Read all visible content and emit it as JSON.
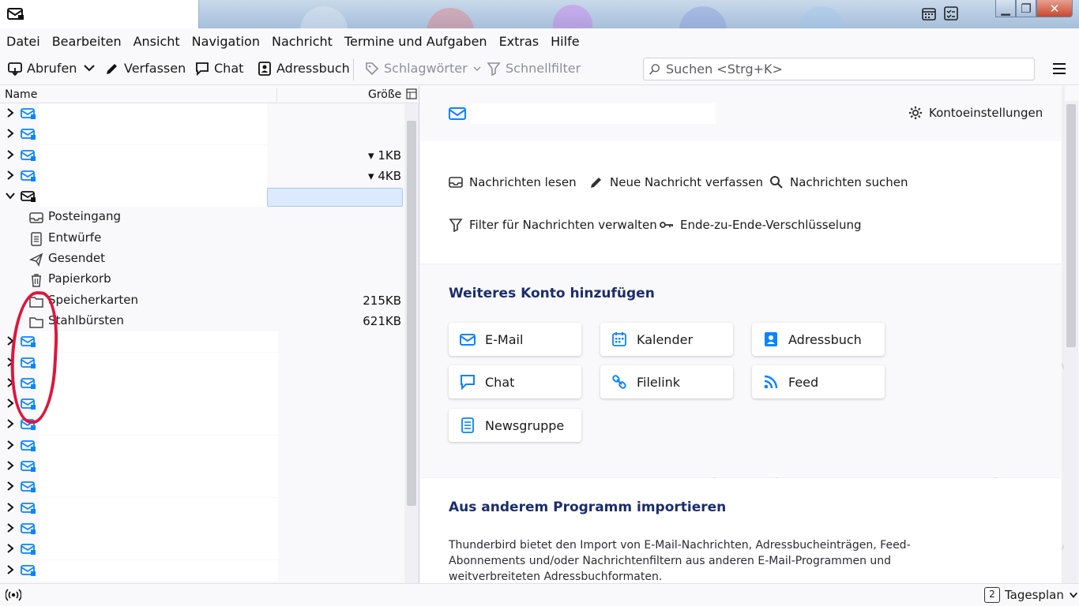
{
  "menu": [
    "Datei",
    "Bearbeiten",
    "Ansicht",
    "Navigation",
    "Nachricht",
    "Termine und Aufgaben",
    "Extras",
    "Hilfe"
  ],
  "toolbar": {
    "get_mail": "Abrufen",
    "compose": "Verfassen",
    "chat": "Chat",
    "address_book": "Adressbuch",
    "tags": "Schlagwörter",
    "quick_filter": "Schnellfilter",
    "search_placeholder": "Suchen <Strg+K>"
  },
  "folder_pane": {
    "col_name": "Name",
    "col_size": "Größe",
    "accounts_top": [
      {
        "size": ""
      },
      {
        "size": ""
      },
      {
        "size": "1KB"
      },
      {
        "size": "4KB"
      }
    ],
    "folders": [
      {
        "label": "Posteingang",
        "icon": "inbox-icon",
        "size": ""
      },
      {
        "label": "Entwürfe",
        "icon": "drafts-icon",
        "size": ""
      },
      {
        "label": "Gesendet",
        "icon": "sent-icon",
        "size": ""
      },
      {
        "label": "Papierkorb",
        "icon": "trash-icon",
        "size": ""
      },
      {
        "label": "Speicherkarten",
        "icon": "folder-icon",
        "size": "215KB"
      },
      {
        "label": "Stahlbürsten",
        "icon": "folder-icon",
        "size": "621KB"
      }
    ],
    "accounts_bottom_count": 12
  },
  "account_central": {
    "settings": "Kontoeinstellungen",
    "actions": {
      "read": "Nachrichten lesen",
      "compose": "Neue Nachricht verfassen",
      "search": "Nachrichten suchen",
      "filters": "Filter für Nachrichten verwalten",
      "e2e": "Ende-zu-Ende-Verschlüsselung"
    },
    "add_title": "Weiteres Konto hinzufügen",
    "tiles": {
      "email": "E-Mail",
      "calendar": "Kalender",
      "address_book": "Adressbuch",
      "chat": "Chat",
      "filelink": "Filelink",
      "feed": "Feed",
      "newsgroup": "Newsgruppe"
    },
    "import_title": "Aus anderem Programm importieren",
    "import_text": "Thunderbird bietet den Import von E-Mail-Nachrichten, Adressbucheinträgen, Feed-Abonnements und/oder Nachrichtenfiltern aus anderen E-Mail-Programmen und weitverbreiteten Adressbuchformaten."
  },
  "statusbar": {
    "today_pane": "Tagesplan",
    "today_day": "2"
  },
  "colors": {
    "accent_blue": "#0a84ff",
    "title_dark_blue": "#1b2d6b",
    "annotation_red": "#e0153a"
  }
}
